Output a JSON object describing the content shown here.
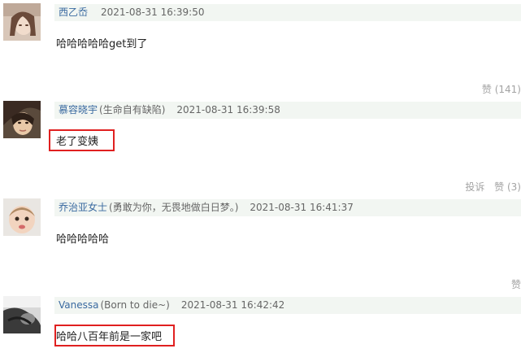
{
  "comments": [
    {
      "name": "西乙岙",
      "signature": "",
      "time": "2021-08-31 16:39:50",
      "text": "哈哈哈哈哈get到了",
      "report": "",
      "like": "赞 (141)"
    },
    {
      "name": "慕容晓宇",
      "signature": "(生命自有缺陷)",
      "time": "2021-08-31 16:39:58",
      "text": "老了变姨",
      "report": "投诉",
      "like": "赞 (3)"
    },
    {
      "name": "乔治亚女士",
      "signature": "(勇敢为你，无畏地做白日梦。)",
      "time": "2021-08-31 16:41:37",
      "text": "哈哈哈哈哈",
      "report": "",
      "like": "赞"
    },
    {
      "name": "Vanessa",
      "signature": "(Born to die~)",
      "time": "2021-08-31 16:42:42",
      "text": "哈哈八百年前是一家吧",
      "report": "",
      "like": ""
    }
  ]
}
